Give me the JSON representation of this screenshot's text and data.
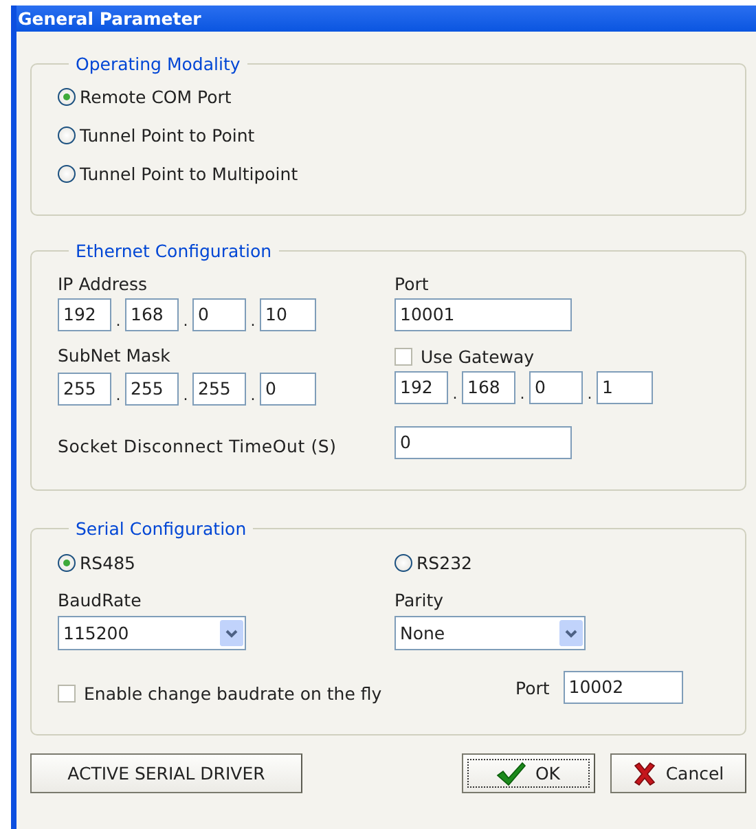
{
  "window": {
    "title": "General Parameter"
  },
  "operating_modality": {
    "title": "Operating Modality",
    "options": [
      {
        "label": "Remote COM Port",
        "selected": true
      },
      {
        "label": "Tunnel Point to Point",
        "selected": false
      },
      {
        "label": "Tunnel Point to Multipoint",
        "selected": false
      }
    ]
  },
  "ethernet": {
    "title": "Ethernet Configuration",
    "ip_address": {
      "label": "IP Address",
      "octets": [
        "192",
        "168",
        "0",
        "10"
      ],
      "separators": [
        ".",
        ".",
        "."
      ]
    },
    "port": {
      "label": "Port",
      "value": "10001"
    },
    "subnet_mask": {
      "label": "SubNet Mask",
      "octets": [
        "255",
        "255",
        "255",
        "0"
      ],
      "separators": [
        ".",
        ".",
        "."
      ]
    },
    "use_gateway": {
      "label": "Use Gateway",
      "checked": false
    },
    "gateway": {
      "octets": [
        "192",
        "168",
        "0",
        "1"
      ],
      "separators": [
        ".",
        ".",
        "."
      ]
    },
    "socket_timeout": {
      "label": "Socket Disconnect TimeOut (S)",
      "value": "0"
    }
  },
  "serial": {
    "title": "Serial Configuration",
    "interfaces": [
      {
        "label": "RS485",
        "selected": true
      },
      {
        "label": "RS232",
        "selected": false
      }
    ],
    "baudrate": {
      "label": "BaudRate",
      "value": "115200"
    },
    "parity": {
      "label": "Parity",
      "value": "None"
    },
    "change_baudrate_on_the_fly": {
      "label": "Enable change baudrate on the fly",
      "checked": false
    },
    "port": {
      "label": "Port",
      "value": "10002"
    }
  },
  "buttons": [
    {
      "label": "ACTIVE SERIAL DRIVER",
      "kind": "plain",
      "focused": false
    },
    {
      "label": "OK",
      "kind": "ok",
      "focused": true
    },
    {
      "label": "Cancel",
      "kind": "cancel",
      "focused": false
    }
  ]
}
